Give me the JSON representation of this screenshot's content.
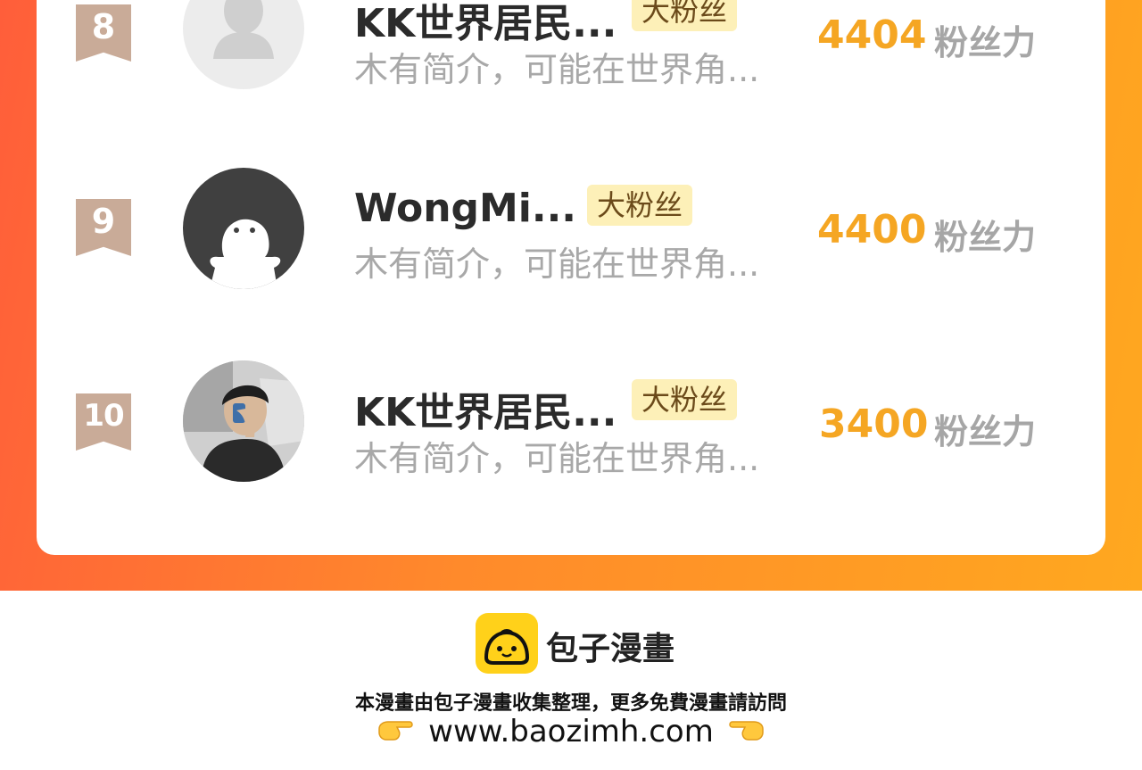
{
  "list": {
    "items": [
      {
        "rank": "8",
        "name": "KK世界居民...",
        "badge": "大粉丝",
        "intro": "木有简介，可能在世界角...",
        "score": "4404",
        "unit": "粉丝力",
        "avatar": "default-avatar-icon"
      },
      {
        "rank": "9",
        "name": "WongMi...",
        "badge": "大粉丝",
        "intro": "木有简介，可能在世界角...",
        "score": "4400",
        "unit": "粉丝力",
        "avatar": "ghost-avatar-icon"
      },
      {
        "rank": "10",
        "name": "KK世界居民...",
        "badge": "大粉丝",
        "intro": "木有简介，可能在世界角...",
        "score": "3400",
        "unit": "粉丝力",
        "avatar": "photo-avatar"
      }
    ]
  },
  "footer": {
    "brand": "包子漫畫",
    "note": "本漫畫由包子漫畫收集整理，更多免費漫畫請訪問",
    "url": "www.baozimh.com"
  },
  "colors": {
    "frame_start": "#ff5e3a",
    "frame_end": "#ffa81f",
    "score": "#f5a623",
    "badge_bg": "#fdf0b8",
    "rank_badge": "#c9ab98",
    "logo": "#ffd11a"
  }
}
